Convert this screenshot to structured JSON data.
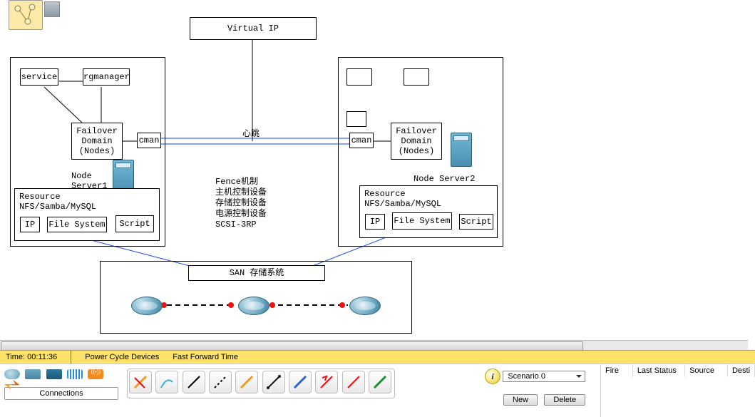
{
  "diagram": {
    "virtual_ip": "Virtual IP",
    "service": "service",
    "rgmanager": "rgmanager",
    "failover1": "Failover\nDomain\n(Nodes)",
    "cman1": "cman",
    "node1_label": "Node\nServer1",
    "heartbeat": "心跳",
    "cman2": "cman",
    "failover2": "Failover\nDomain\n(Nodes)",
    "node2_label": "Node Server2",
    "resource_title": "Resource\nNFS/Samba/MySQL",
    "ip": "IP",
    "filesystem": "File System",
    "script": "Script",
    "fence_block": "Fence机制\n主机控制设备\n存储控制设备\n电源控制设备\nSCSI-3RP",
    "san": "SAN 存储系统"
  },
  "status": {
    "time_label": "Time:",
    "time_value": "00:11:36",
    "power_cycle": "Power Cycle Devices",
    "ffwd": "Fast Forward Time"
  },
  "toolbar": {
    "connections": "Connections",
    "scenario": "Scenario 0",
    "new_btn": "New",
    "delete_btn": "Delete"
  },
  "grid": {
    "col_fire": "Fire",
    "col_last": "Last Status",
    "col_source": "Source",
    "col_dest": "Desti"
  }
}
